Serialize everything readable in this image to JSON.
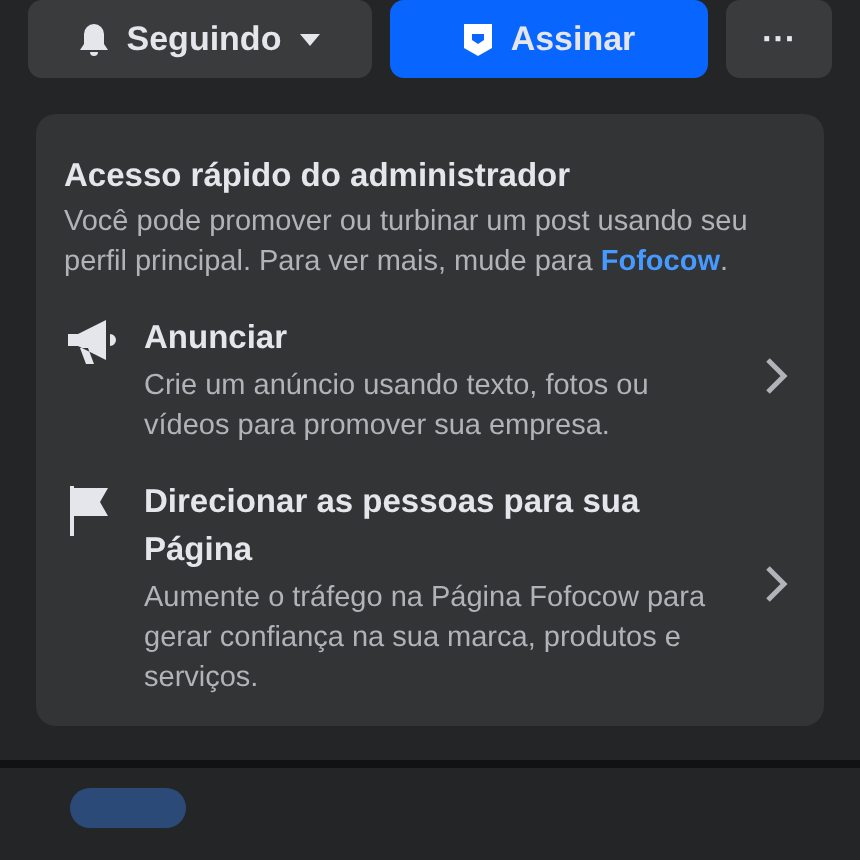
{
  "actions": [
    {
      "kind": "follow",
      "label": "Seguindo"
    },
    {
      "kind": "subscribe",
      "label": "Assinar"
    },
    {
      "kind": "more",
      "label": "···"
    }
  ],
  "admin_card": {
    "title": "Acesso rápido do administrador",
    "description": "Você pode promover ou turbinar um post usando seu perfil principal. Para ver mais, mude para",
    "link": "Fofocow",
    "link_suffix": ".",
    "items": [
      {
        "kind": "megaphone",
        "title": "Anunciar",
        "description": "Crie um anúncio usando texto, fotos ou vídeos para promover sua empresa."
      },
      {
        "kind": "flag",
        "title": "Direcionar as pessoas para sua Página",
        "description": "Aumente o tráfego na Página Fofocow para gerar confiança na sua marca, produtos e serviços."
      }
    ]
  }
}
